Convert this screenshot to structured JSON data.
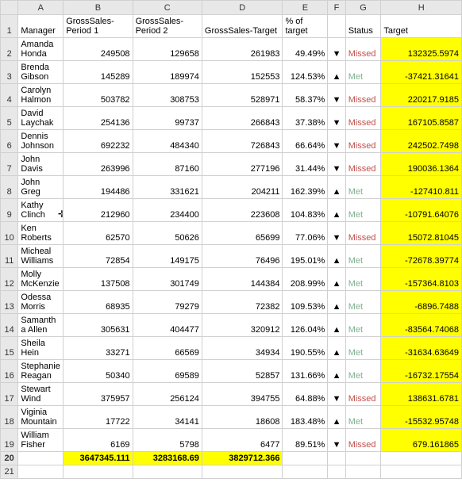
{
  "columns": {
    "rowhdr": "",
    "A": "A",
    "B": "B",
    "C": "C",
    "D": "D",
    "E": "E",
    "F": "F",
    "G": "G",
    "H": "H"
  },
  "headers": {
    "manager": "Manager",
    "gs1": "GrossSales-Period 1",
    "gs2": "GrossSales-Period 2",
    "gstarget": "GrossSales-Target",
    "pct": "% of target",
    "status_arrow": "",
    "status": "Status",
    "target": "Target"
  },
  "rows": [
    {
      "n": "2",
      "manager": "Amanda Honda",
      "gs1": "249508",
      "gs2": "129658",
      "gstarget": "261983",
      "pct": "49.49%",
      "arrow": "▼",
      "status": "Missed",
      "target": "132325.5974"
    },
    {
      "n": "3",
      "manager": "Brenda Gibson",
      "gs1": "145289",
      "gs2": "189974",
      "gstarget": "152553",
      "pct": "124.53%",
      "arrow": "▲",
      "status": "Met",
      "target": "-37421.31641"
    },
    {
      "n": "4",
      "manager": "Carolyn Halmon",
      "gs1": "503782",
      "gs2": "308753",
      "gstarget": "528971",
      "pct": "58.37%",
      "arrow": "▼",
      "status": "Missed",
      "target": "220217.9185"
    },
    {
      "n": "5",
      "manager": "David Laychak",
      "gs1": "254136",
      "gs2": "99737",
      "gstarget": "266843",
      "pct": "37.38%",
      "arrow": "▼",
      "status": "Missed",
      "target": "167105.8587"
    },
    {
      "n": "6",
      "manager": "Dennis Johnson",
      "gs1": "692232",
      "gs2": "484340",
      "gstarget": "726843",
      "pct": "66.64%",
      "arrow": "▼",
      "status": "Missed",
      "target": "242502.7498"
    },
    {
      "n": "7",
      "manager": "John Davis",
      "gs1": "263996",
      "gs2": "87160",
      "gstarget": "277196",
      "pct": "31.44%",
      "arrow": "▼",
      "status": "Missed",
      "target": "190036.1364"
    },
    {
      "n": "8",
      "manager": "John Greg",
      "gs1": "194486",
      "gs2": "331621",
      "gstarget": "204211",
      "pct": "162.39%",
      "arrow": "▲",
      "status": "Met",
      "target": "-127410.811"
    },
    {
      "n": "9",
      "manager": "Kathy Clinch",
      "gs1": "212960",
      "gs2": "234400",
      "gstarget": "223608",
      "pct": "104.83%",
      "arrow": "▲",
      "status": "Met",
      "target": "-10791.64076"
    },
    {
      "n": "10",
      "manager": "Ken Roberts",
      "gs1": "62570",
      "gs2": "50626",
      "gstarget": "65699",
      "pct": "77.06%",
      "arrow": "▼",
      "status": "Missed",
      "target": "15072.81045"
    },
    {
      "n": "11",
      "manager": "Micheal Williams",
      "gs1": "72854",
      "gs2": "149175",
      "gstarget": "76496",
      "pct": "195.01%",
      "arrow": "▲",
      "status": "Met",
      "target": "-72678.39774"
    },
    {
      "n": "12",
      "manager": "Molly McKenzie",
      "gs1": "137508",
      "gs2": "301749",
      "gstarget": "144384",
      "pct": "208.99%",
      "arrow": "▲",
      "status": "Met",
      "target": "-157364.8103"
    },
    {
      "n": "13",
      "manager": "Odessa Morris",
      "gs1": "68935",
      "gs2": "79279",
      "gstarget": "72382",
      "pct": "109.53%",
      "arrow": "▲",
      "status": "Met",
      "target": "-6896.7488"
    },
    {
      "n": "14",
      "manager": "Samantha Allen",
      "gs1": "305631",
      "gs2": "404477",
      "gstarget": "320912",
      "pct": "126.04%",
      "arrow": "▲",
      "status": "Met",
      "target": "-83564.74068"
    },
    {
      "n": "15",
      "manager": "Sheila Hein",
      "gs1": "33271",
      "gs2": "66569",
      "gstarget": "34934",
      "pct": "190.55%",
      "arrow": "▲",
      "status": "Met",
      "target": "-31634.63649"
    },
    {
      "n": "16",
      "manager": "Stephanie Reagan",
      "gs1": "50340",
      "gs2": "69589",
      "gstarget": "52857",
      "pct": "131.66%",
      "arrow": "▲",
      "status": "Met",
      "target": "-16732.17554"
    },
    {
      "n": "17",
      "manager": "Stewart Wind",
      "gs1": "375957",
      "gs2": "256124",
      "gstarget": "394755",
      "pct": "64.88%",
      "arrow": "▼",
      "status": "Missed",
      "target": "138631.6781"
    },
    {
      "n": "18",
      "manager": "Viginia Mountain",
      "gs1": "17722",
      "gs2": "34141",
      "gstarget": "18608",
      "pct": "183.48%",
      "arrow": "▲",
      "status": "Met",
      "target": "-15532.95748"
    },
    {
      "n": "19",
      "manager": "William Fisher",
      "gs1": "6169",
      "gs2": "5798",
      "gstarget": "6477",
      "pct": "89.51%",
      "arrow": "▼",
      "status": "Missed",
      "target": "679.161865"
    }
  ],
  "totals": {
    "n": "20",
    "gs1": "3647345.111",
    "gs2": "3283168.69",
    "gstarget": "3829712.366"
  },
  "extra_row": {
    "n": "21"
  },
  "cursor": "✛"
}
